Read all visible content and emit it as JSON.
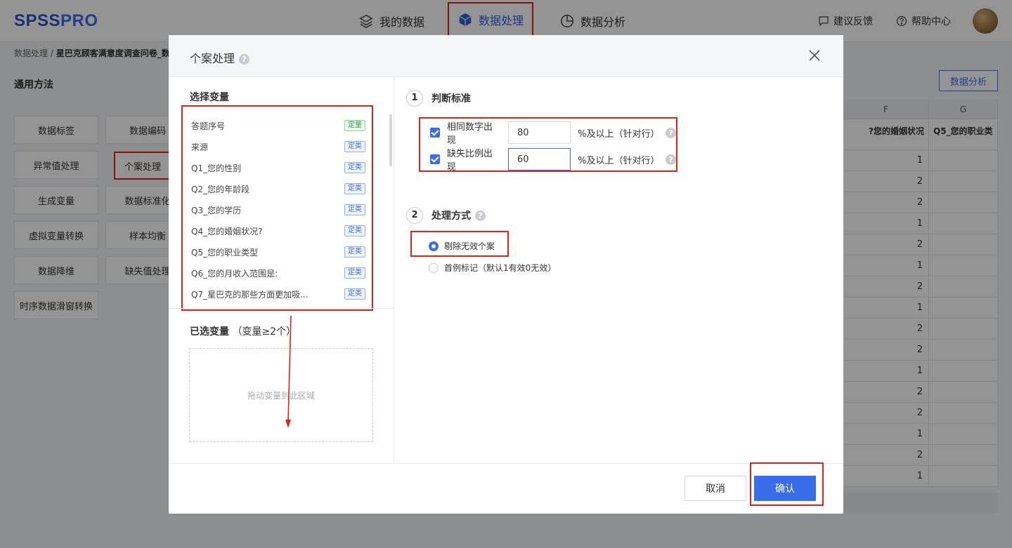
{
  "app": {
    "logo_main": "SPSS",
    "logo_accent": "PRO",
    "nav": [
      {
        "label": "我的数据",
        "icon": "layers-icon"
      },
      {
        "label": "数据处理",
        "icon": "cube-icon"
      },
      {
        "label": "数据分析",
        "icon": "pie-chart-icon"
      }
    ],
    "feedback_label": "建议反馈",
    "help_label": "帮助中心"
  },
  "breadcrumb": {
    "root": "数据处理 /",
    "current": "星巴克顾客满意度调查问卷_数"
  },
  "methods": {
    "title": "通用方法",
    "items": [
      "数据标签",
      "数据编码",
      "异常值处理",
      "个案处理",
      "生成变量",
      "数据标准化",
      "虚拟变量转换",
      "样本均衡",
      "数据降维",
      "缺失值处理",
      "时序数据滑窗转换"
    ]
  },
  "table": {
    "analyze_button": "数据分析",
    "columns": [
      "F",
      "G"
    ],
    "field_headers": [
      "您的婚姻状况?",
      "Q5_您的职业类"
    ],
    "values": [
      1,
      2,
      2,
      1,
      2,
      1,
      2,
      1,
      2,
      2,
      1,
      2,
      2,
      1,
      2,
      1
    ]
  },
  "modal": {
    "title": "个案处理",
    "help": "?",
    "select_title": "选择变量",
    "variables": [
      {
        "name": "答题序号",
        "tag": "定量"
      },
      {
        "name": "来源",
        "tag": "定类"
      },
      {
        "name": "Q1_您的性别",
        "tag": "定类"
      },
      {
        "name": "Q2_您的年龄段",
        "tag": "定类"
      },
      {
        "name": "Q3_您的学历",
        "tag": "定类"
      },
      {
        "name": "Q4_您的婚姻状况?",
        "tag": "定类"
      },
      {
        "name": "Q5_您的职业类型",
        "tag": "定类"
      },
      {
        "name": "Q6_您的月收入范围是:",
        "tag": "定类"
      },
      {
        "name": "Q7_星巴克的那些方面更加吸...",
        "tag": "定类"
      }
    ],
    "selected_title": "已选变量",
    "selected_hint": "（变量≥2个）",
    "drop_placeholder": "拖动变量到此区域",
    "step1": {
      "num": "1",
      "title": "判断标准"
    },
    "criteria": [
      {
        "label": "相同数字出现",
        "value": "80",
        "suffix": "%及以上（针对行）"
      },
      {
        "label": "缺失比例出现",
        "value": "60",
        "suffix": "%及以上（针对行）"
      }
    ],
    "step2": {
      "num": "2",
      "title": "处理方式"
    },
    "options": [
      "剔除无效个案",
      "首例标记（默认1有效0无效）"
    ],
    "cancel": "取消",
    "confirm": "确认"
  },
  "colors": {
    "accent": "#3a6ee8",
    "highlight": "#e2231a"
  }
}
